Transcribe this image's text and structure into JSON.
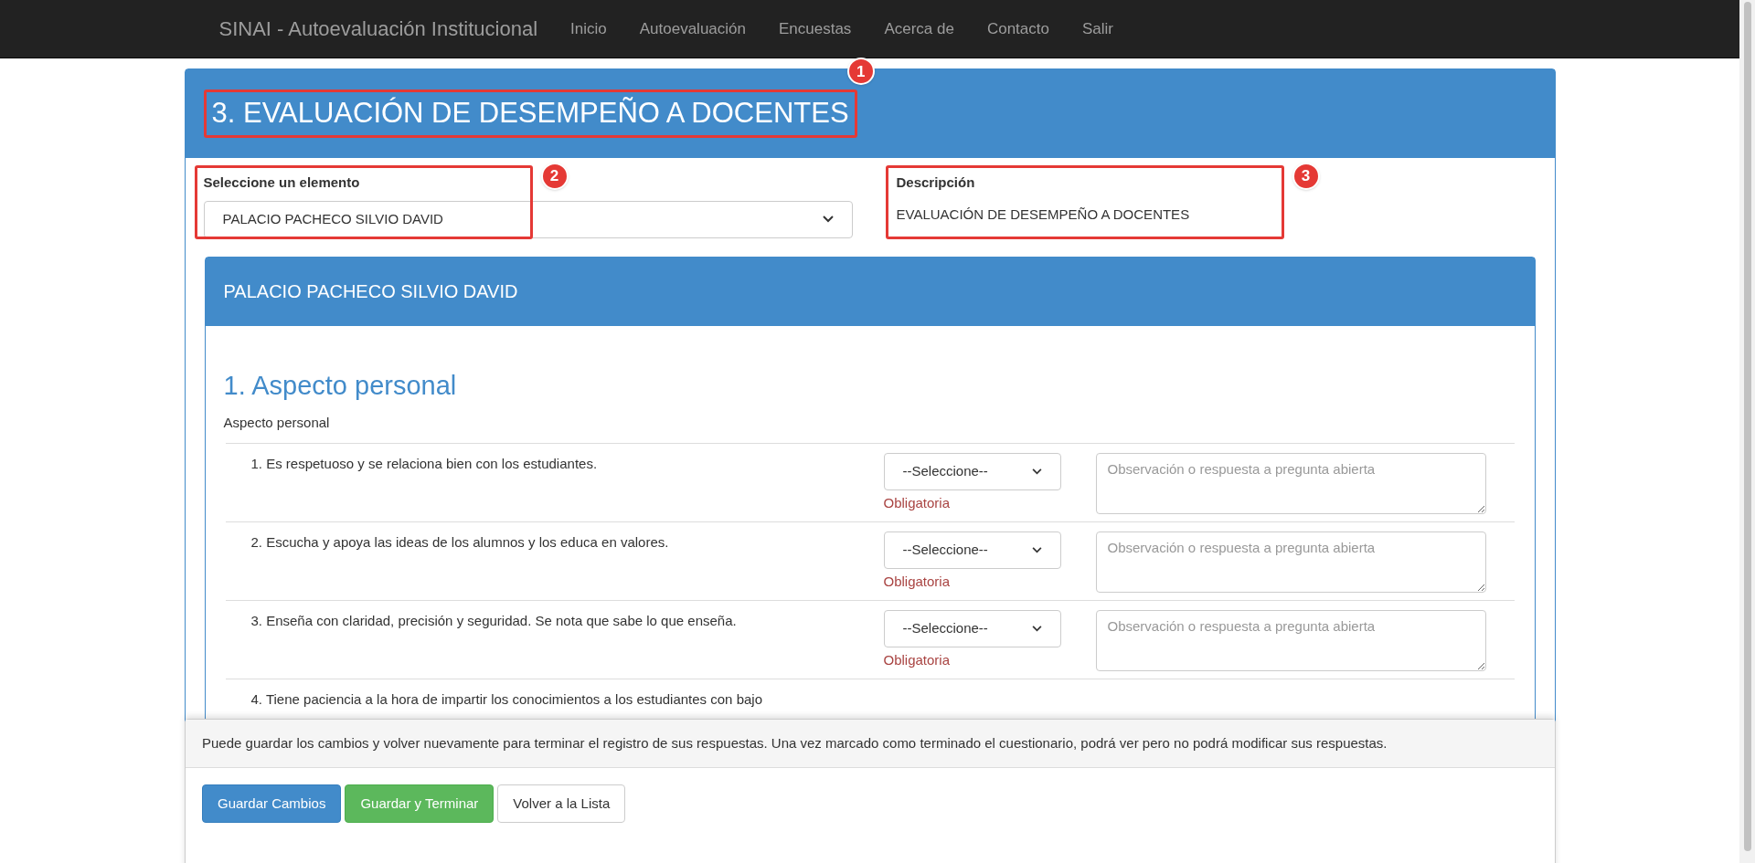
{
  "navbar": {
    "brand": "SINAI - Autoevaluación Institucional",
    "links": [
      "Inicio",
      "Autoevaluación",
      "Encuestas",
      "Acerca de",
      "Contacto",
      "Salir"
    ]
  },
  "header": {
    "title": "3. EVALUACIÓN DE DESEMPEÑO A DOCENTES",
    "marker": "1"
  },
  "selector": {
    "label": "Seleccione un elemento",
    "value": "PALACIO PACHECO SILVIO DAVID",
    "marker": "2"
  },
  "description": {
    "label": "Descripción",
    "text": "EVALUACIÓN DE DESEMPEÑO A DOCENTES",
    "marker": "3"
  },
  "panel": {
    "title": "PALACIO PACHECO SILVIO DAVID",
    "section_number": "1.",
    "section_title": "Aspecto personal",
    "section_subtitle": "Aspecto personal",
    "questions": [
      {
        "text": "1. Es respetuoso y se relaciona bien con los estudiantes.",
        "answer": "--Seleccione--",
        "required": "Obligatoria",
        "placeholder": "Observación o respuesta a pregunta abierta"
      },
      {
        "text": "2. Escucha y apoya las ideas de los alumnos y los educa en valores.",
        "answer": "--Seleccione--",
        "required": "Obligatoria",
        "placeholder": "Observación o respuesta a pregunta abierta"
      },
      {
        "text": "3. Enseña con claridad, precisión y seguridad. Se nota que sabe lo que enseña.",
        "answer": "--Seleccione--",
        "required": "Obligatoria",
        "placeholder": "Observación o respuesta a pregunta abierta"
      },
      {
        "text": "4. Tiene paciencia a la hora de impartir los conocimientos a los estudiantes con bajo"
      }
    ]
  },
  "footer": {
    "note": "Puede guardar los cambios y volver nuevamente para terminar el registro de sus respuestas. Una vez marcado como terminado el cuestionario, podrá ver pero no podrá modificar sus respuestas.",
    "buttons": [
      {
        "label": "Guardar Cambios",
        "kind": "primary"
      },
      {
        "label": "Guardar y Terminar",
        "kind": "success"
      },
      {
        "label": "Volver a la Lista",
        "kind": "default"
      }
    ]
  }
}
